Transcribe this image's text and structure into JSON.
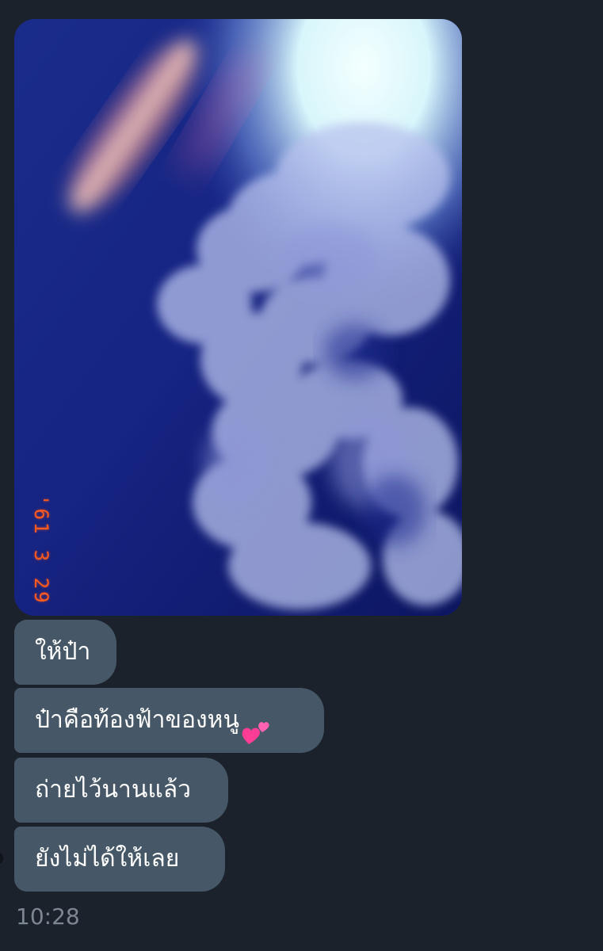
{
  "chat": {
    "photo": {
      "subject": "sky-and-clouds-photo",
      "film_date_stamp": "'61 3 29"
    },
    "messages": [
      {
        "text": "ให้ป๋า"
      },
      {
        "text": "ป๋าคือท้องฟ้าของหนู",
        "emoji": "two-hearts-icon"
      },
      {
        "text": "ถ่ายไว้นานแล้ว"
      },
      {
        "text": "ยังไม่ได้ให้เลย"
      }
    ],
    "time": "10:28"
  },
  "colors": {
    "background": "#1b222c",
    "bubble": "#465867",
    "bubble_text": "#ffffff",
    "timestamp": "#7d8792",
    "film_stamp": "#ff5a1f",
    "heart": "#ff4aa3"
  }
}
